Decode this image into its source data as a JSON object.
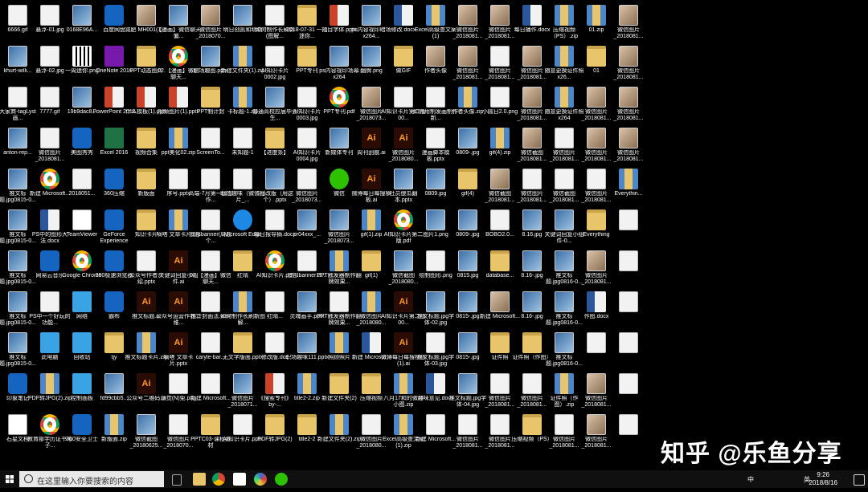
{
  "desktop": {
    "icons": [
      {
        "label": "6666.gif",
        "type": "file"
      },
      {
        "label": "悬浮-01.jpg",
        "type": "file"
      },
      {
        "label": "0168E96A...",
        "type": "img"
      },
      {
        "label": "百度网盘",
        "type": "app"
      },
      {
        "label": "减肥 MH001(1)...",
        "type": "photo"
      },
      {
        "label": "【漫画】微信聊天偏...",
        "type": "img"
      },
      {
        "label": "微信图片_2018070...",
        "type": "photo"
      },
      {
        "label": "明日创凯和晴晴",
        "type": "img"
      },
      {
        "label": "如何制作长刷新(图解...",
        "type": "file"
      },
      {
        "label": "2018-07-31 一周迷你...",
        "type": "folder"
      },
      {
        "label": "拦目字体.pptx",
        "type": "ppt"
      },
      {
        "label": "ps内容视印暗场 x264...",
        "type": "img"
      },
      {
        "label": "修改.docx",
        "type": "word"
      },
      {
        "label": "Excel高级查文案(1)",
        "type": "zip"
      },
      {
        "label": "微信图片_2018081...",
        "type": "photo"
      },
      {
        "label": "微信图片_2018081...",
        "type": "photo"
      },
      {
        "label": "每日播作.docx",
        "type": "word"
      },
      {
        "label": "压缩视频（PS）.zip",
        "type": "zip"
      },
      {
        "label": "01.zip",
        "type": "zip"
      },
      {
        "label": "微信图片_2018081...",
        "type": "photo"
      },
      {
        "label": "khurt-willi...",
        "type": "img"
      },
      {
        "label": "悬浮-02.jpg",
        "type": "file"
      },
      {
        "label": "一周迷你.png",
        "type": "qr"
      },
      {
        "label": "OneNote 2016",
        "type": "onenote"
      },
      {
        "label": "PPT动态图片",
        "type": "folder"
      },
      {
        "label": "02.【漫画】微信聊天...",
        "type": "chrome"
      },
      {
        "label": "职场趣图.pptx",
        "type": "img"
      },
      {
        "label": "新建文件夹(1).zip",
        "type": "zip"
      },
      {
        "label": "AI知识卡片0002.jpg",
        "type": "file"
      },
      {
        "label": "PPT专刊",
        "type": "folder"
      },
      {
        "label": "ps内容视印场幕 x264",
        "type": "img"
      },
      {
        "label": "翻牌.png",
        "type": "img"
      },
      {
        "label": "做GIF",
        "type": "folder"
      },
      {
        "label": "作者头像",
        "type": "photo"
      },
      {
        "label": "微信图片_2018081...",
        "type": "photo"
      },
      {
        "label": "微信图片_2018081...",
        "type": "file"
      },
      {
        "label": "微信图片_2018081...",
        "type": "photo"
      },
      {
        "label": "随意更换证件照 x26...",
        "type": "zip"
      },
      {
        "label": "01",
        "type": "folder"
      },
      {
        "label": "微信图片_2018081...",
        "type": "photo"
      },
      {
        "label": "大家商-tagLyst画...",
        "type": "file"
      },
      {
        "label": "7777.gif",
        "type": "file"
      },
      {
        "label": "19b9dac8...",
        "type": "img"
      },
      {
        "label": "PowerPoint 2016",
        "type": "ppt"
      },
      {
        "label": "什么模板(1).pptx",
        "type": "ppt"
      },
      {
        "label": "视频图片(1).pptx",
        "type": "ppt"
      },
      {
        "label": "PPT制计封",
        "type": "folder"
      },
      {
        "label": "卡标题-1.zip",
        "type": "zip"
      },
      {
        "label": "普通高校应届毕业生...",
        "type": "img"
      },
      {
        "label": "AI知识卡片0003.jpg",
        "type": "file"
      },
      {
        "label": "PPT专刊.pdf",
        "type": "chrome"
      },
      {
        "label": "微信图片_2018073...",
        "type": "photo"
      },
      {
        "label": "AI知识卡片第二版00...",
        "type": "file"
      },
      {
        "label": "如何用制发画制作新...",
        "type": "file"
      },
      {
        "label": "作者头像.zip",
        "type": "zip"
      },
      {
        "label": "小圆日2.0.png",
        "type": "file"
      },
      {
        "label": "微信图片_2018081...",
        "type": "photo"
      },
      {
        "label": "随意更换证件照 x264",
        "type": "zip"
      },
      {
        "label": "微信图片_2018081...",
        "type": "photo"
      },
      {
        "label": "微信图片_2018081...",
        "type": "photo"
      },
      {
        "label": "anton-rep...",
        "type": "img"
      },
      {
        "label": "微信图片_2018081...",
        "type": "file"
      },
      {
        "label": "美图秀秀",
        "type": "app"
      },
      {
        "label": "Excel 2016",
        "type": "excel"
      },
      {
        "label": "视频合集",
        "type": "folder"
      },
      {
        "label": "ppt美化02.zip",
        "type": "zip"
      },
      {
        "label": "ScreenTo...",
        "type": "file"
      },
      {
        "label": "未知题-1",
        "type": "file"
      },
      {
        "label": "【进度条】",
        "type": "folder"
      },
      {
        "label": "AI知识卡片0004.jpg",
        "type": "file"
      },
      {
        "label": "新媒体专刊",
        "type": "img"
      },
      {
        "label": "周刊刮痕.ai",
        "type": "ai"
      },
      {
        "label": "微信图片_2018080...",
        "type": "ai"
      },
      {
        "label": "漫画脚本模板.pptx",
        "type": "file"
      },
      {
        "label": "0809-.jpg",
        "type": "img"
      },
      {
        "label": "gif(4).zip",
        "type": "zip"
      },
      {
        "label": "微信截图_2018081...",
        "type": "photo"
      },
      {
        "label": "微信图片_2018081...",
        "type": "file"
      },
      {
        "label": "微信图片_2018081...",
        "type": "photo"
      },
      {
        "label": "微信图片_2018081...",
        "type": "photo"
      },
      {
        "label": "推文标题.jpg0815-0...",
        "type": "img"
      },
      {
        "label": "新建 Microsoft...",
        "type": "chrome"
      },
      {
        "label": "2018051...",
        "type": "file"
      },
      {
        "label": "360压缩",
        "type": "app"
      },
      {
        "label": "新版面",
        "type": "folder"
      },
      {
        "label": "序号.pptx",
        "type": "file"
      },
      {
        "label": "高端-7月第一版工作...",
        "type": "file"
      },
      {
        "label": "职场趣味（微信图片_...",
        "type": "file"
      },
      {
        "label": "6月改版（用这个）.pptx",
        "type": "img"
      },
      {
        "label": "微信图片_2018073...",
        "type": "file"
      },
      {
        "label": "微信",
        "type": "wechat"
      },
      {
        "label": "微博每日每搜横板.ai",
        "type": "ai"
      },
      {
        "label": "社员傻瓜翻本.pptx",
        "type": "img"
      },
      {
        "label": "0809.jpg",
        "type": "img"
      },
      {
        "label": "gif(4)",
        "type": "folder"
      },
      {
        "label": "微信截图_2018081...",
        "type": "photo"
      },
      {
        "label": "微信图片_2018081...",
        "type": "file"
      },
      {
        "label": "微信截图_2018081...",
        "type": "file"
      },
      {
        "label": "微信图片_2018081...",
        "type": "file"
      },
      {
        "label": "Everythin...",
        "type": "zip"
      },
      {
        "label": "推文标题.jpg0815-0...",
        "type": "img"
      },
      {
        "label": "PS中的图形大法.docx",
        "type": "word"
      },
      {
        "label": "TeamViewer",
        "type": "web"
      },
      {
        "label": "GeForce Experience",
        "type": "app"
      },
      {
        "label": "知识卡片",
        "type": "folder"
      },
      {
        "label": "嘀嗒 文章卡片.zip",
        "type": "zip"
      },
      {
        "label": "底部banner(周边个...",
        "type": "file"
      },
      {
        "label": "Microsoft Edge",
        "type": "edge"
      },
      {
        "label": "每日报导摘.docx",
        "type": "file"
      },
      {
        "label": "pr04xxx_...",
        "type": "img"
      },
      {
        "label": "微信图片_2018073...",
        "type": "img"
      },
      {
        "label": "gif(1).zip",
        "type": "zip"
      },
      {
        "label": "AI知识卡片第二版.pdf",
        "type": "chrome"
      },
      {
        "label": "图片1.png",
        "type": "img"
      },
      {
        "label": "0809-.jpg",
        "type": "img"
      },
      {
        "label": "BOBO2.0...",
        "type": "file"
      },
      {
        "label": "8.16.jpg",
        "type": "img"
      },
      {
        "label": "关键词回复小组件-0...",
        "type": "img"
      },
      {
        "label": "Everything",
        "type": "folder"
      },
      {
        "label": "",
        "type": "file"
      },
      {
        "label": "推文标题.jpg0815-0...",
        "type": "img"
      },
      {
        "label": "网易云音乐",
        "type": "app"
      },
      {
        "label": "Google Chrome",
        "type": "chrome"
      },
      {
        "label": "360极速浏览器",
        "type": "app"
      },
      {
        "label": "公众号作者介绍.pptx",
        "type": "file"
      },
      {
        "label": "关键词回复小组件.ai",
        "type": "ai"
      },
      {
        "label": "02.【漫画】微信聊天...",
        "type": "file"
      },
      {
        "label": "红晴",
        "type": "folder"
      },
      {
        "label": "AI知识卡片.pdf",
        "type": "chrome"
      },
      {
        "label": "底部banner11...",
        "type": "file"
      },
      {
        "label": "PPT触发器制作翻牌效果...",
        "type": "zip"
      },
      {
        "label": "gif(1)",
        "type": "folder"
      },
      {
        "label": "微信截图_2018080...",
        "type": "img"
      },
      {
        "label": "绘制图形.png",
        "type": "file"
      },
      {
        "label": "0815.jpg",
        "type": "img"
      },
      {
        "label": "database...",
        "type": "folder"
      },
      {
        "label": "8.16-.jpg",
        "type": "img"
      },
      {
        "label": "推文标题.jpg0816-0...",
        "type": "img"
      },
      {
        "label": "微信图片_2018081...",
        "type": "photo"
      },
      {
        "label": "",
        "type": "file"
      },
      {
        "label": "推文标题.jpg0815-0...",
        "type": "img"
      },
      {
        "label": "PS中一个好玩的功能...",
        "type": "file"
      },
      {
        "label": "网络",
        "type": "pc"
      },
      {
        "label": "霸布",
        "type": "app"
      },
      {
        "label": "推文标题.ai",
        "type": "ai"
      },
      {
        "label": "公众号运营作者二维...",
        "type": "ai"
      },
      {
        "label": "推计封面法.wav",
        "type": "file"
      },
      {
        "label": "如何制作长刷新图解...",
        "type": "zip"
      },
      {
        "label": "红晴...",
        "type": "file"
      },
      {
        "label": "灵魂画手.pptx",
        "type": "img"
      },
      {
        "label": "PPT触发器制作翻牌效果...",
        "type": "file"
      },
      {
        "label": "微信图片_2018080...",
        "type": "zip"
      },
      {
        "label": "AI知识卡片第二版00...",
        "type": "ai"
      },
      {
        "label": "推文标题.jpg字体-02.jpg",
        "type": "img"
      },
      {
        "label": "0815-.jpg",
        "type": "img"
      },
      {
        "label": "新建 Microsoft...",
        "type": "photo"
      },
      {
        "label": "8.16-.jpg",
        "type": "img"
      },
      {
        "label": "推文标题.jpg0816-0...",
        "type": "img"
      },
      {
        "label": "作图.docx",
        "type": "word"
      },
      {
        "label": "",
        "type": "file"
      },
      {
        "label": "推文标题.jpg0815-0...",
        "type": "img"
      },
      {
        "label": "此电脑",
        "type": "pc"
      },
      {
        "label": "回收站",
        "type": "pc"
      },
      {
        "label": "tjy",
        "type": "folder"
      },
      {
        "label": "推文标题卡片.zip",
        "type": "zip"
      },
      {
        "label": "嘀嗒 文章卡片.pptx",
        "type": "ai"
      },
      {
        "label": "caryle-bar...",
        "type": "file"
      },
      {
        "label": "无文字版面.pptx",
        "type": "folder"
      },
      {
        "label": "修改版.doc",
        "type": "file"
      },
      {
        "label": "职场趣味111.pptx",
        "type": "img"
      },
      {
        "label": "照顾照片",
        "type": "zip"
      },
      {
        "label": "新建 Microsof...",
        "type": "word"
      },
      {
        "label": "微博每日每搜横板(1).ai",
        "type": "ai"
      },
      {
        "label": "推文标题.jpg字体-03.jpg",
        "type": "file"
      },
      {
        "label": "0815-.jpg",
        "type": "img"
      },
      {
        "label": "证件照",
        "type": "folder"
      },
      {
        "label": "证件照（作图）",
        "type": "folder"
      },
      {
        "label": "推文标题.jpg0816-0...",
        "type": "img"
      },
      {
        "label": "",
        "type": "file"
      },
      {
        "label": "",
        "type": "file"
      },
      {
        "label": "印象笔记",
        "type": "app"
      },
      {
        "label": "PDF转JPG(2).zip",
        "type": "zip"
      },
      {
        "label": "控制面板",
        "type": "pc"
      },
      {
        "label": "fd99cbb5...",
        "type": "img"
      },
      {
        "label": "公众号二维码.ai",
        "type": "ai"
      },
      {
        "label": "感觉(N)免.png",
        "type": "file"
      },
      {
        "label": "新建 Microsoft...",
        "type": "file"
      },
      {
        "label": "微信图片_2018071...",
        "type": "img"
      },
      {
        "label": "《搜索专刊》by-...",
        "type": "ppt"
      },
      {
        "label": "title2-2.zip",
        "type": "zip"
      },
      {
        "label": "新建文件夹(2)",
        "type": "folder"
      },
      {
        "label": "压缩视频",
        "type": "folder"
      },
      {
        "label": "八月17和的微博小图.zip",
        "type": "zip"
      },
      {
        "label": "趣味意见.docx",
        "type": "word"
      },
      {
        "label": "推文标题.jpg字体-04.jpg",
        "type": "img"
      },
      {
        "label": "微信图片_2018081...",
        "type": "file"
      },
      {
        "label": "微信图片_2018081...",
        "type": "file"
      },
      {
        "label": "证件照（作图）.zip",
        "type": "zip"
      },
      {
        "label": "微信图片_2018081...",
        "type": "photo"
      },
      {
        "label": "",
        "type": "file"
      },
      {
        "label": "石星文档",
        "type": "web"
      },
      {
        "label": "教育部学历证书电子...",
        "type": "chrome"
      },
      {
        "label": "360安全卫士",
        "type": "app"
      },
      {
        "label": "新版面.zip",
        "type": "zip"
      },
      {
        "label": "微信截图_20180625...",
        "type": "img"
      },
      {
        "label": "微信图片_2018070...",
        "type": "file"
      },
      {
        "label": "PPTC03-课程素材",
        "type": "folder"
      },
      {
        "label": "AI知识卡片.pptx",
        "type": "file"
      },
      {
        "label": "PDF转JPG(2)",
        "type": "folder"
      },
      {
        "label": "title2-2",
        "type": "folder"
      },
      {
        "label": "新建文件夹(2).zip",
        "type": "zip"
      },
      {
        "label": "微信图片_2018080...",
        "type": "file"
      },
      {
        "label": "Excel高级查文案(1).zip",
        "type": "zip"
      },
      {
        "label": "新建 Microsoft...",
        "type": "file"
      },
      {
        "label": "微信图片_2018081...",
        "type": "file"
      },
      {
        "label": "微信图片_2018081...",
        "type": "file"
      },
      {
        "label": "压缩视频（PS）",
        "type": "folder"
      },
      {
        "label": "微信图片_2018081...",
        "type": "file"
      },
      {
        "label": "微信图片_2018081...",
        "type": "photo"
      },
      {
        "label": "",
        "type": "file"
      }
    ]
  },
  "watermark": {
    "text": "知乎 @乐鱼分享"
  },
  "taskbar": {
    "search_placeholder": "在这里输入你要搜索的内容",
    "time": "9:26",
    "date": "2018/8/16",
    "ime": "中",
    "lang": "英"
  }
}
